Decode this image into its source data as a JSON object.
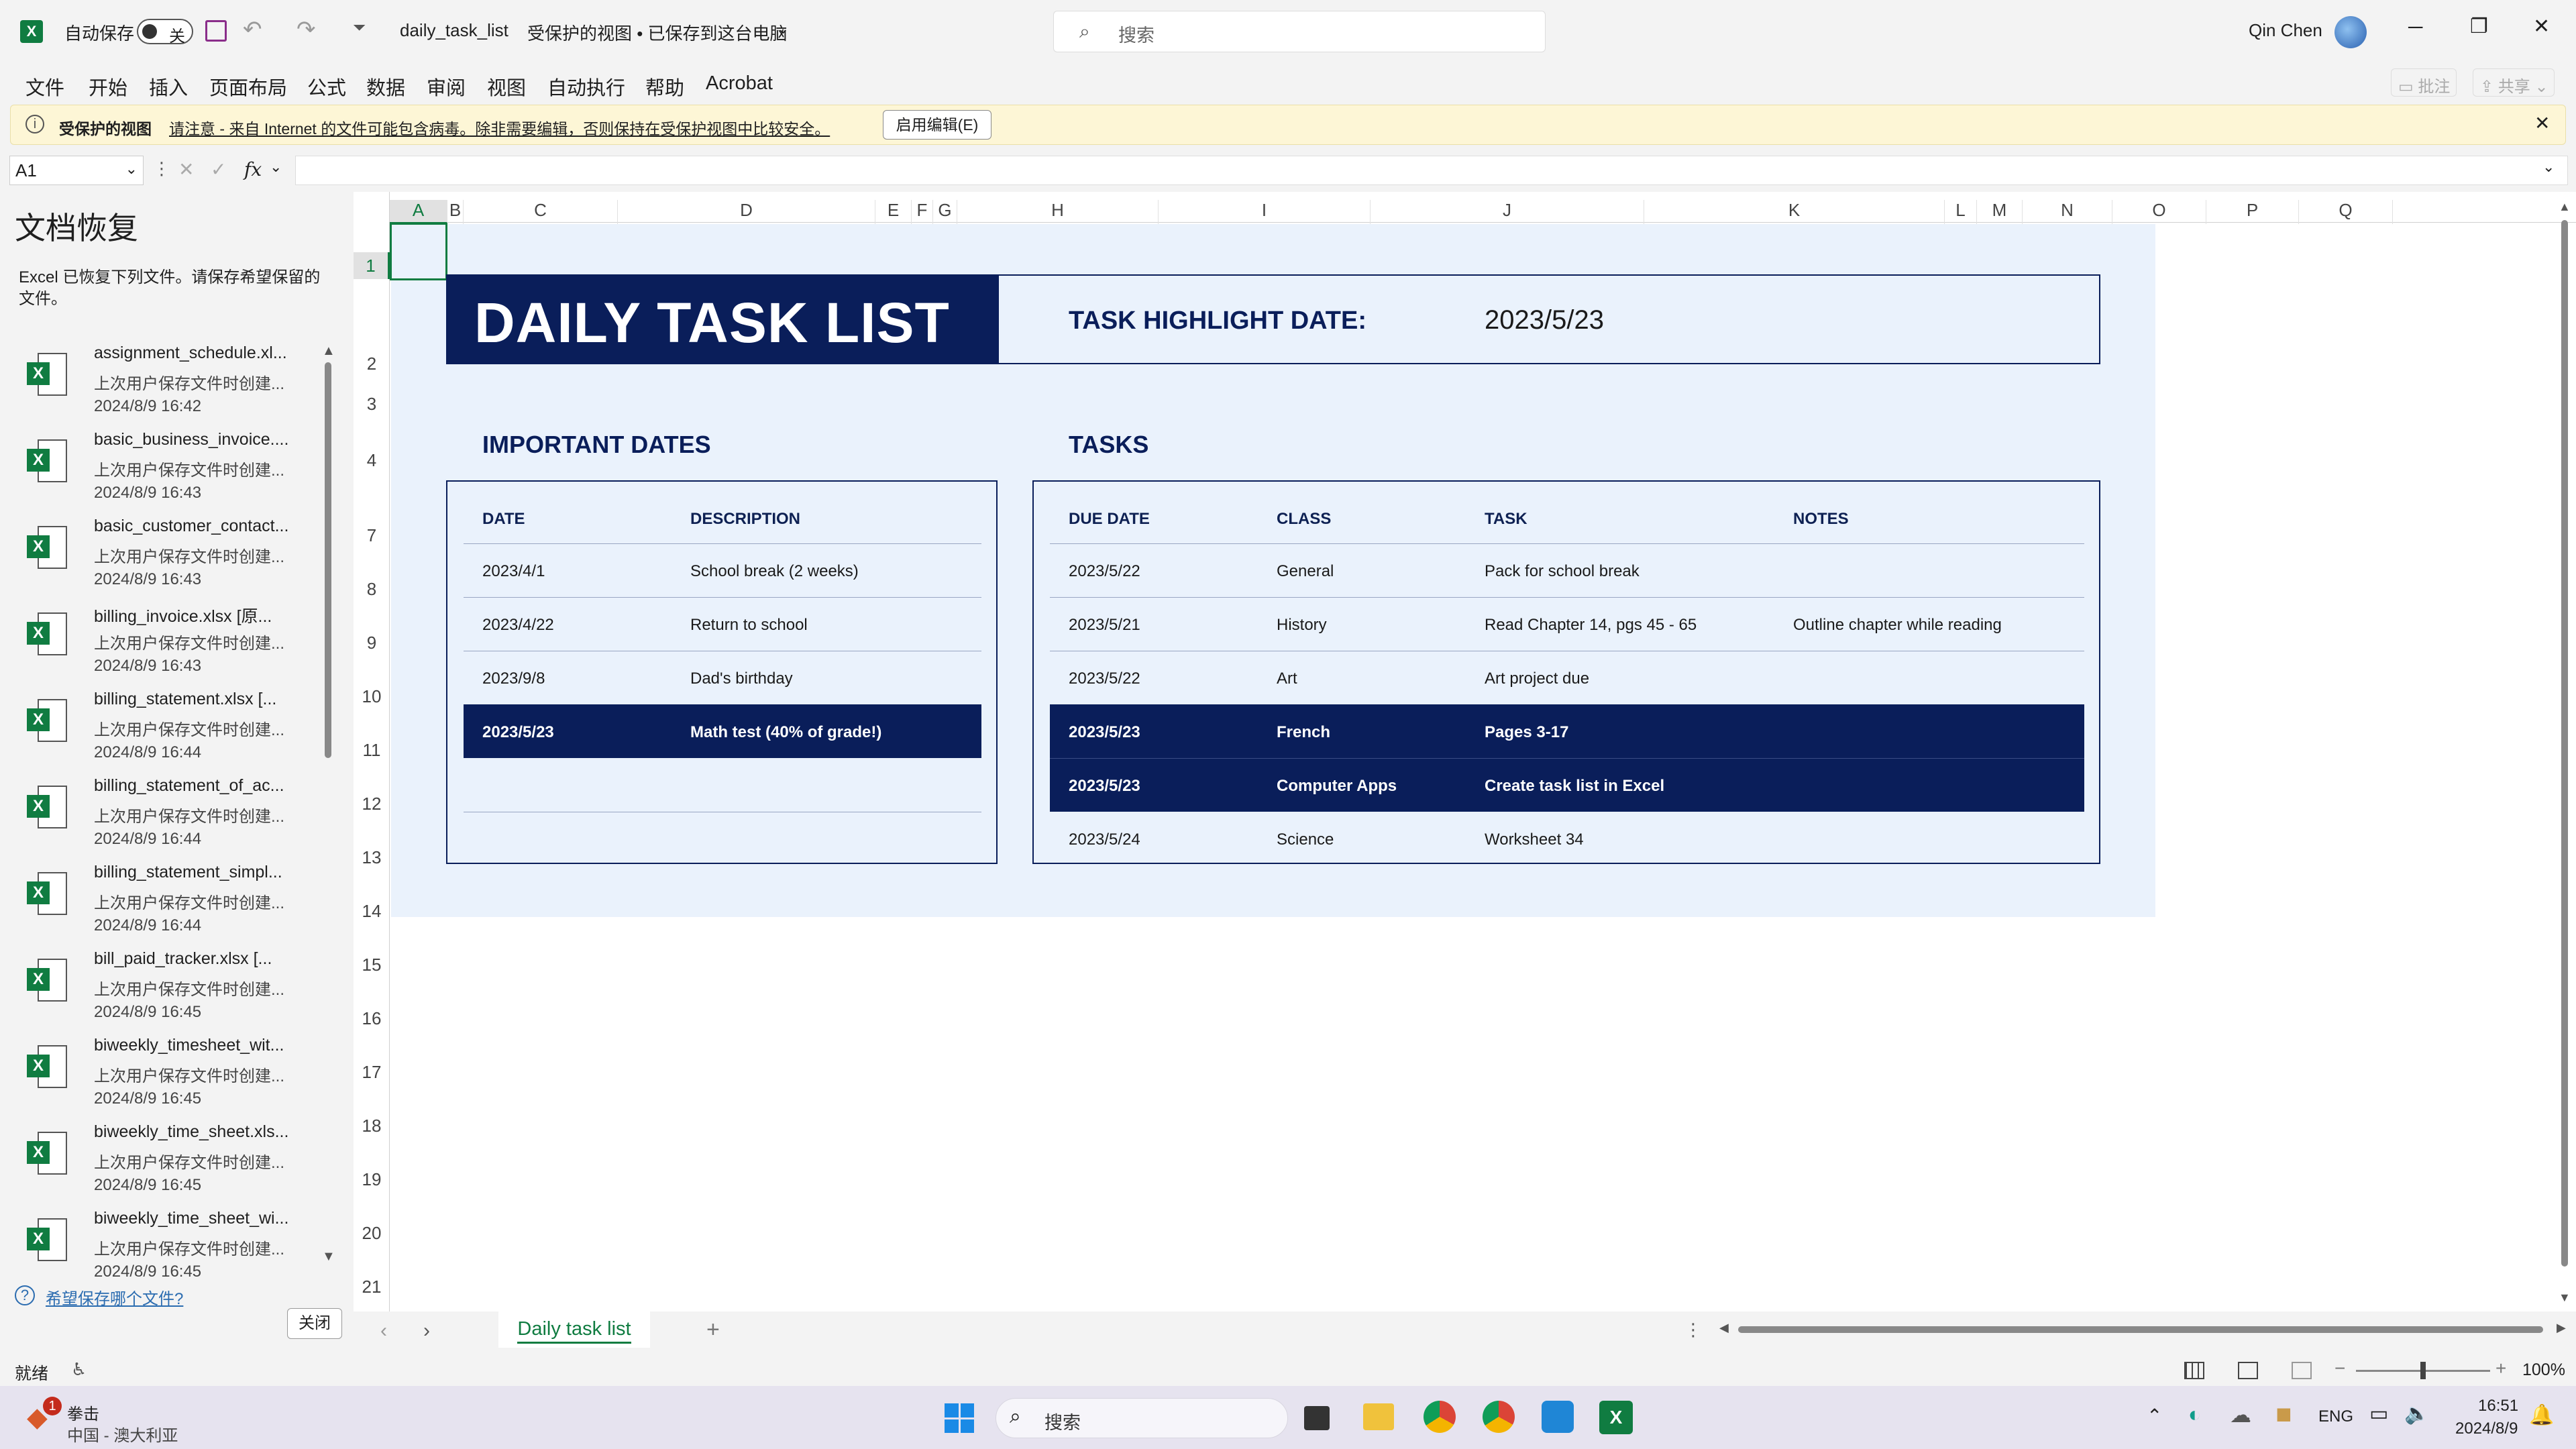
{
  "app": {
    "autosave_label": "自动保存",
    "autosave_state": "关",
    "doc_title": "daily_task_list",
    "doc_status": "受保护的视图 • 已保存到这台电脑",
    "search_placeholder": "搜索",
    "user_name": "Qin Chen"
  },
  "menu": [
    "文件",
    "开始",
    "插入",
    "页面布局",
    "公式",
    "数据",
    "审阅",
    "视图",
    "自动执行",
    "帮助",
    "Acrobat"
  ],
  "ribbon_right": {
    "comment": "批注",
    "share": "共享"
  },
  "infobar": {
    "title": "受保护的视图",
    "message": "请注意 - 来自 Internet 的文件可能包含病毒。除非需要编辑，否则保持在受保护视图中比较安全。",
    "button": "启用编辑(E)"
  },
  "formula": {
    "name_box": "A1",
    "fx": "fx"
  },
  "recovery": {
    "title": "文档恢复",
    "description": "Excel 已恢复下列文件。请保存希望保留的文件。",
    "files": [
      {
        "name": "assignment_schedule.xl...",
        "sub": "上次用户保存文件时创建...",
        "date": "2024/8/9 16:42"
      },
      {
        "name": "basic_business_invoice....",
        "sub": "上次用户保存文件时创建...",
        "date": "2024/8/9 16:43"
      },
      {
        "name": "basic_customer_contact...",
        "sub": "上次用户保存文件时创建...",
        "date": "2024/8/9 16:43"
      },
      {
        "name": "billing_invoice.xlsx  [原...",
        "sub": "上次用户保存文件时创建...",
        "date": "2024/8/9 16:43"
      },
      {
        "name": "billing_statement.xlsx  [...",
        "sub": "上次用户保存文件时创建...",
        "date": "2024/8/9 16:44"
      },
      {
        "name": "billing_statement_of_ac...",
        "sub": "上次用户保存文件时创建...",
        "date": "2024/8/9 16:44"
      },
      {
        "name": "billing_statement_simpl...",
        "sub": "上次用户保存文件时创建...",
        "date": "2024/8/9 16:44"
      },
      {
        "name": "bill_paid_tracker.xlsx  [...",
        "sub": "上次用户保存文件时创建...",
        "date": "2024/8/9 16:45"
      },
      {
        "name": "biweekly_timesheet_wit...",
        "sub": "上次用户保存文件时创建...",
        "date": "2024/8/9 16:45"
      },
      {
        "name": "biweekly_time_sheet.xls...",
        "sub": "上次用户保存文件时创建...",
        "date": "2024/8/9 16:45"
      },
      {
        "name": "biweekly_time_sheet_wi...",
        "sub": "上次用户保存文件时创建...",
        "date": "2024/8/9 16:45"
      }
    ],
    "help_link": "希望保存哪个文件?",
    "close_button": "关闭"
  },
  "columns": [
    "A",
    "B",
    "C",
    "D",
    "E",
    "F",
    "G",
    "H",
    "I",
    "J",
    "K",
    "L",
    "M",
    "N",
    "O",
    "P",
    "Q"
  ],
  "rows": [
    "1",
    "2",
    "3",
    "4",
    "7",
    "8",
    "9",
    "10",
    "11",
    "12",
    "13",
    "14",
    "15",
    "16",
    "17",
    "18",
    "19",
    "20",
    "21"
  ],
  "sheet": {
    "title": "DAILY TASK LIST",
    "highlight_label": "TASK HIGHLIGHT DATE:",
    "highlight_date": "2023/5/23",
    "important_dates": {
      "heading": "IMPORTANT DATES",
      "headers": [
        "DATE",
        "DESCRIPTION"
      ],
      "rows": [
        [
          "2023/4/1",
          "School break (2 weeks)"
        ],
        [
          "2023/4/22",
          "Return to school"
        ],
        [
          "2023/9/8",
          "Dad's birthday"
        ],
        [
          "2023/5/23",
          "Math test (40% of grade!)"
        ]
      ]
    },
    "tasks": {
      "heading": "TASKS",
      "headers": [
        "DUE DATE",
        "CLASS",
        "TASK",
        "NOTES"
      ],
      "rows": [
        [
          "2023/5/22",
          "General",
          "Pack for school break",
          ""
        ],
        [
          "2023/5/21",
          "History",
          "Read Chapter 14, pgs 45 - 65",
          "Outline chapter while reading"
        ],
        [
          "2023/5/22",
          "Art",
          "Art project due",
          ""
        ],
        [
          "2023/5/23",
          "French",
          "Pages 3-17",
          ""
        ],
        [
          "2023/5/23",
          "Computer Apps",
          "Create task list in Excel",
          ""
        ],
        [
          "2023/5/24",
          "Science",
          "Worksheet 34",
          ""
        ]
      ]
    }
  },
  "sheet_tab": "Daily task list",
  "status": {
    "ready": "就绪",
    "zoom": "100%"
  },
  "taskbar": {
    "weather_title": "拳击",
    "weather_sub": "中国 - 澳大利亚",
    "badge": "1",
    "search": "搜索",
    "lang": "ENG",
    "time": "16:51",
    "date": "2024/8/9"
  }
}
